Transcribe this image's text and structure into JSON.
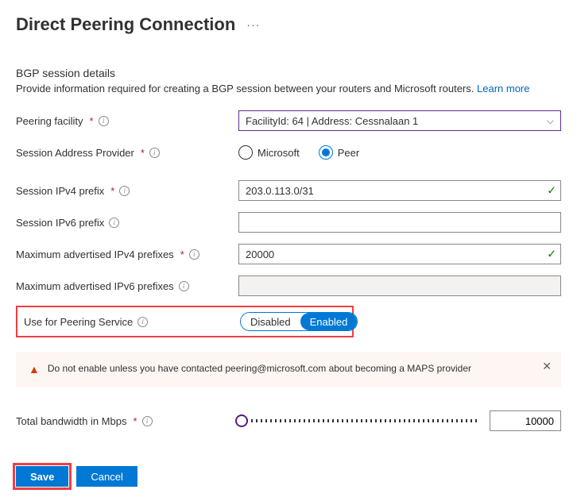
{
  "title": "Direct Peering Connection",
  "section_heading": "BGP session details",
  "section_subtext": "Provide information required for creating a BGP session between your routers and Microsoft routers.",
  "learn_more": "Learn more",
  "fields": {
    "peering_facility": {
      "label": "Peering facility",
      "value": "FacilityId: 64 | Address: Cessnalaan 1"
    },
    "session_address_provider": {
      "label": "Session Address Provider",
      "option_microsoft": "Microsoft",
      "option_peer": "Peer"
    },
    "ipv4_prefix": {
      "label": "Session IPv4 prefix",
      "value": "203.0.113.0/31"
    },
    "ipv6_prefix": {
      "label": "Session IPv6 prefix",
      "value": ""
    },
    "max_v4": {
      "label": "Maximum advertised IPv4 prefixes",
      "value": "20000"
    },
    "max_v6": {
      "label": "Maximum advertised IPv6 prefixes",
      "value": ""
    },
    "peering_service": {
      "label": "Use for Peering Service",
      "disabled": "Disabled",
      "enabled": "Enabled"
    },
    "bandwidth": {
      "label": "Total bandwidth in Mbps",
      "value": "10000"
    }
  },
  "warning_text": "Do not enable unless you have contacted peering@microsoft.com about becoming a MAPS provider",
  "footer": {
    "save": "Save",
    "cancel": "Cancel"
  }
}
